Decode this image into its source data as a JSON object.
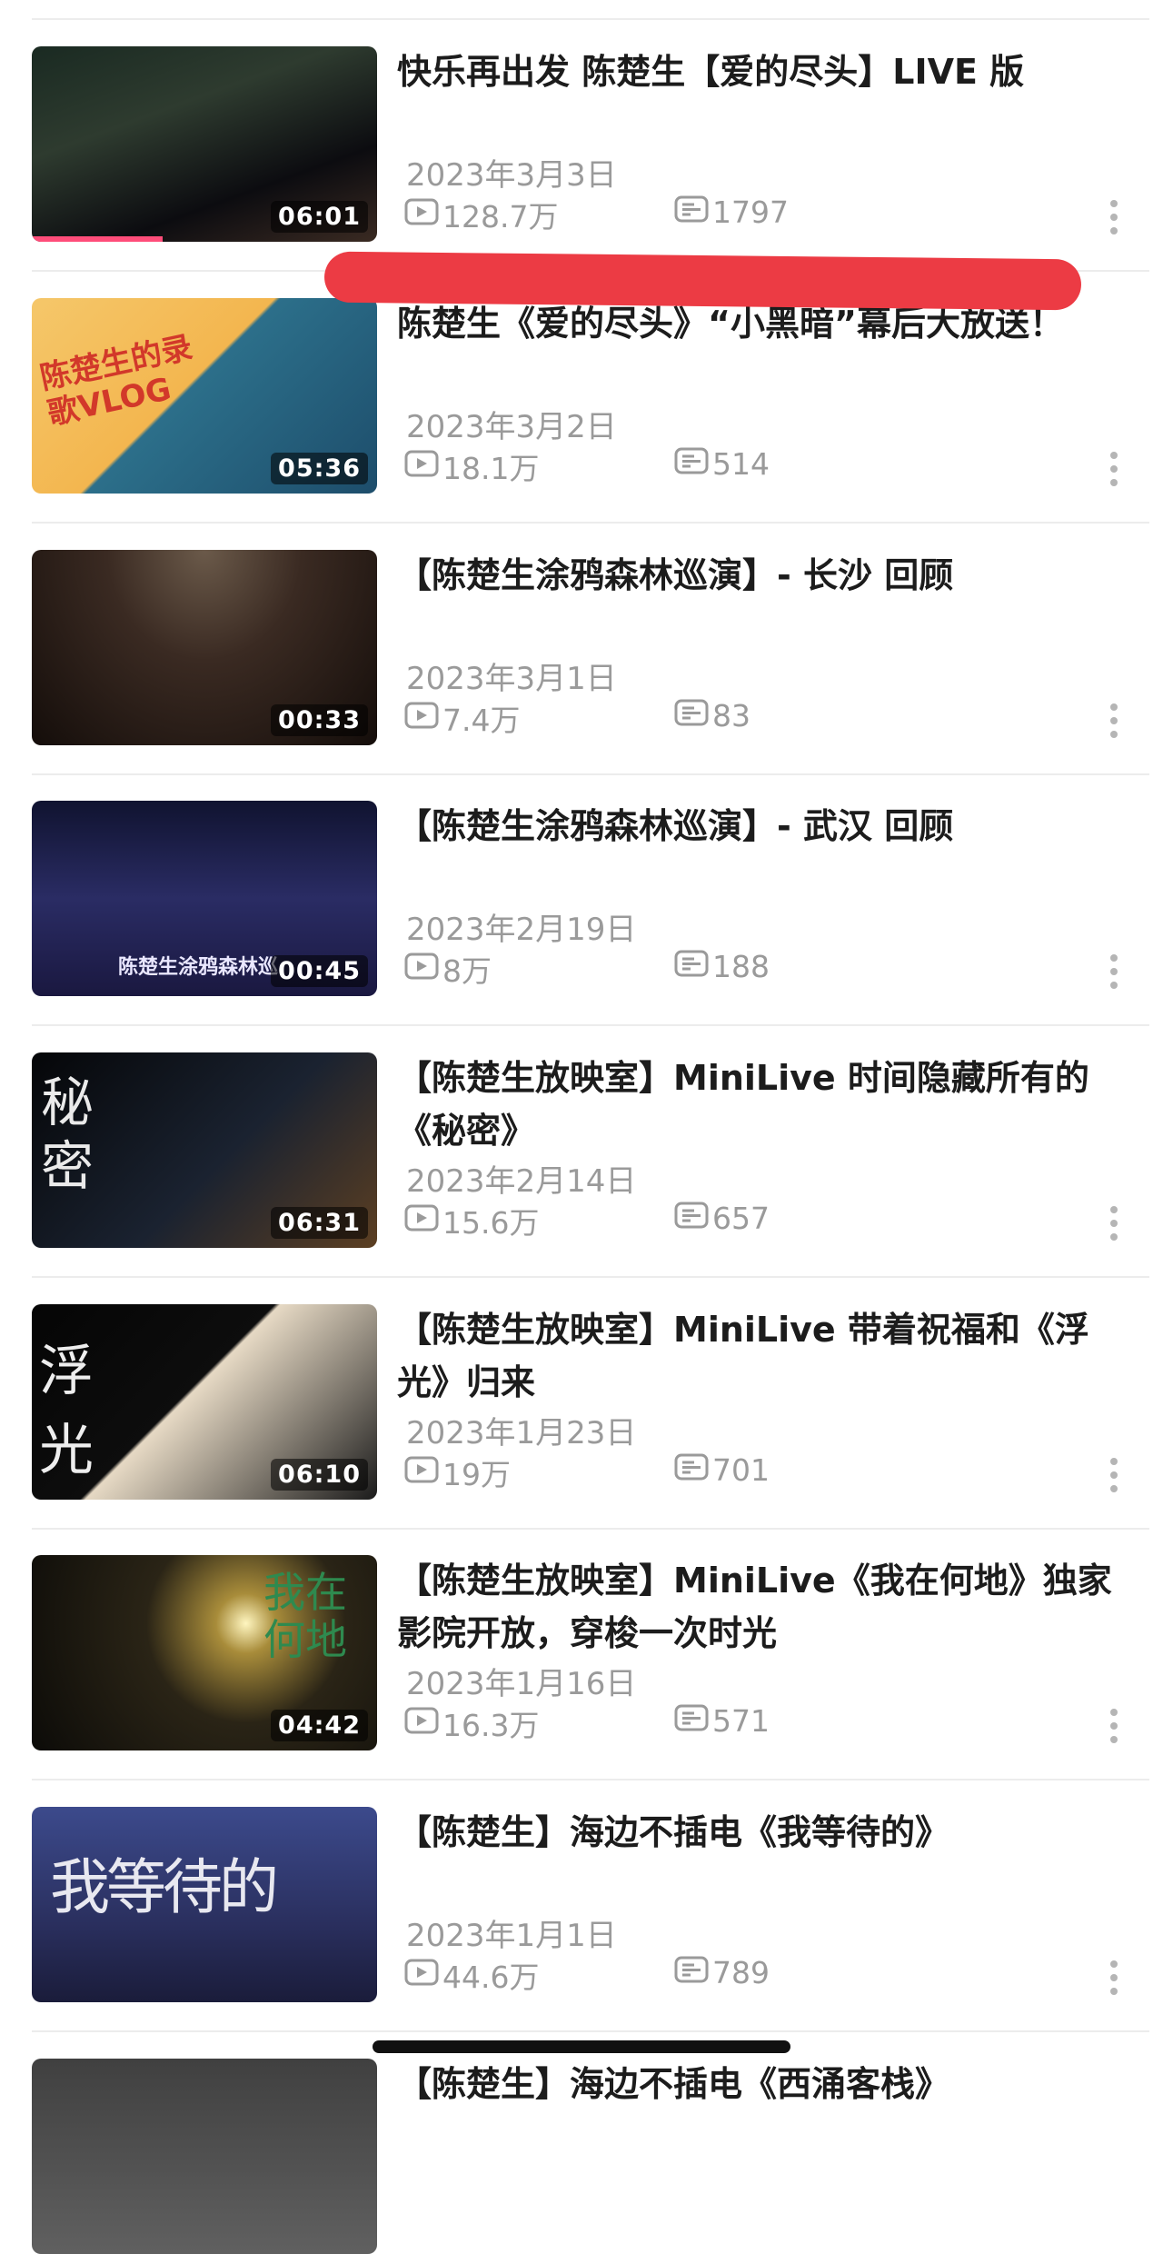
{
  "videos": [
    {
      "title": "快乐再出发 陈楚生【爱的尽头】LIVE 版",
      "date": "2023年3月3日",
      "views": "128.7万",
      "danmaku": "1797",
      "duration": "06:01",
      "progress": 0.38
    },
    {
      "title": "陈楚生《爱的尽头》“小黑暗”幕后大放送！",
      "date": "2023年3月2日",
      "views": "18.1万",
      "danmaku": "514",
      "duration": "05:36",
      "thumb_text": "陈楚生的录歌VLOG"
    },
    {
      "title": "【陈楚生涂鸦森林巡演】- 长沙 回顾",
      "date": "2023年3月1日",
      "views": "7.4万",
      "danmaku": "83",
      "duration": "00:33"
    },
    {
      "title": "【陈楚生涂鸦森林巡演】- 武汉 回顾",
      "date": "2023年2月19日",
      "views": "8万",
      "danmaku": "188",
      "duration": "00:45",
      "thumb_text": "陈楚生涂鸦森林巡"
    },
    {
      "title": "【陈楚生放映室】MiniLive 时间隐藏所有的《秘密》",
      "date": "2023年2月14日",
      "views": "15.6万",
      "danmaku": "657",
      "duration": "06:31",
      "thumb_text": "秘密"
    },
    {
      "title": "【陈楚生放映室】MiniLive 带着祝福和《浮光》归来",
      "date": "2023年1月23日",
      "views": "19万",
      "danmaku": "701",
      "duration": "06:10",
      "thumb_text": "浮 光"
    },
    {
      "title": "【陈楚生放映室】MiniLive《我在何地》独家影院开放，穿梭一次时光",
      "date": "2023年1月16日",
      "views": "16.3万",
      "danmaku": "571",
      "duration": "04:42",
      "thumb_text": "我在何地"
    },
    {
      "title": "【陈楚生】海边不插电《我等待的》",
      "date": "2023年1月1日",
      "views": "44.6万",
      "danmaku": "789",
      "duration": "",
      "thumb_text": "我等待的"
    },
    {
      "title": "【陈楚生】海边不插电《西涌客栈》",
      "date": "",
      "views": "",
      "danmaku": "",
      "duration": ""
    }
  ],
  "icons": {
    "views": "play-count-icon",
    "danmaku": "danmaku-icon",
    "more": "more-vertical-icon"
  },
  "colors": {
    "meta_gray": "#9a9a9a",
    "redaction": "#ec3b44",
    "progress": "#ff4d7a"
  }
}
